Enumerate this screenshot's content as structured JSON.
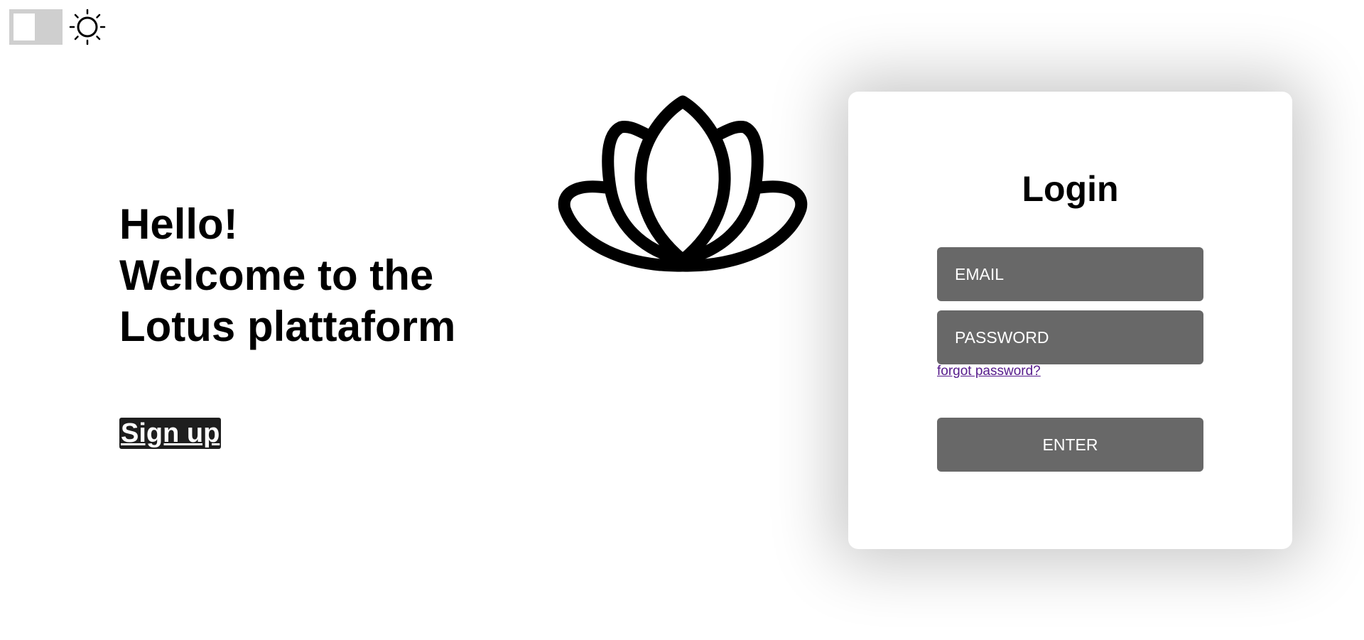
{
  "theme_toggle": {
    "state": "light",
    "icon": "sun-icon"
  },
  "hero": {
    "line1": "Hello!",
    "line2": "Welcome to the",
    "line3": "Lotus plattaform",
    "signup_label": "Sign up"
  },
  "logo": {
    "icon": "lotus-icon"
  },
  "login": {
    "title": "Login",
    "email_placeholder": "EMAIL",
    "password_placeholder": "PASSWORD",
    "forgot_label": "forgot password?",
    "enter_label": "ENTER"
  },
  "colors": {
    "field_bg": "#686868",
    "signup_bg": "#1e1e1e",
    "toggle_bg": "#cfcfcf",
    "link": "#551a8b"
  }
}
